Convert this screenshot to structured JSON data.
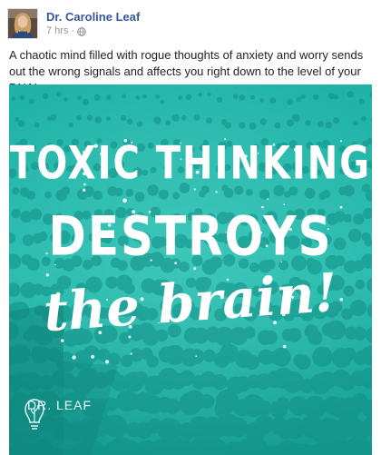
{
  "post": {
    "author": "Dr. Caroline Leaf",
    "time": "7 hrs",
    "separator": "·",
    "audience_icon": "globe-icon",
    "caption": "A chaotic mind filled with rogue thoughts of anxiety and worry sends out the wrong signals and affects you right down to the level of your DNA!"
  },
  "image": {
    "line1": "Toxic Thinking",
    "line2": "Destroys",
    "line3": "the brain!",
    "logo_text": "DR. LEAF",
    "logo_icon": "lightbulb-icon",
    "tint_color": "#2bb8ab"
  }
}
